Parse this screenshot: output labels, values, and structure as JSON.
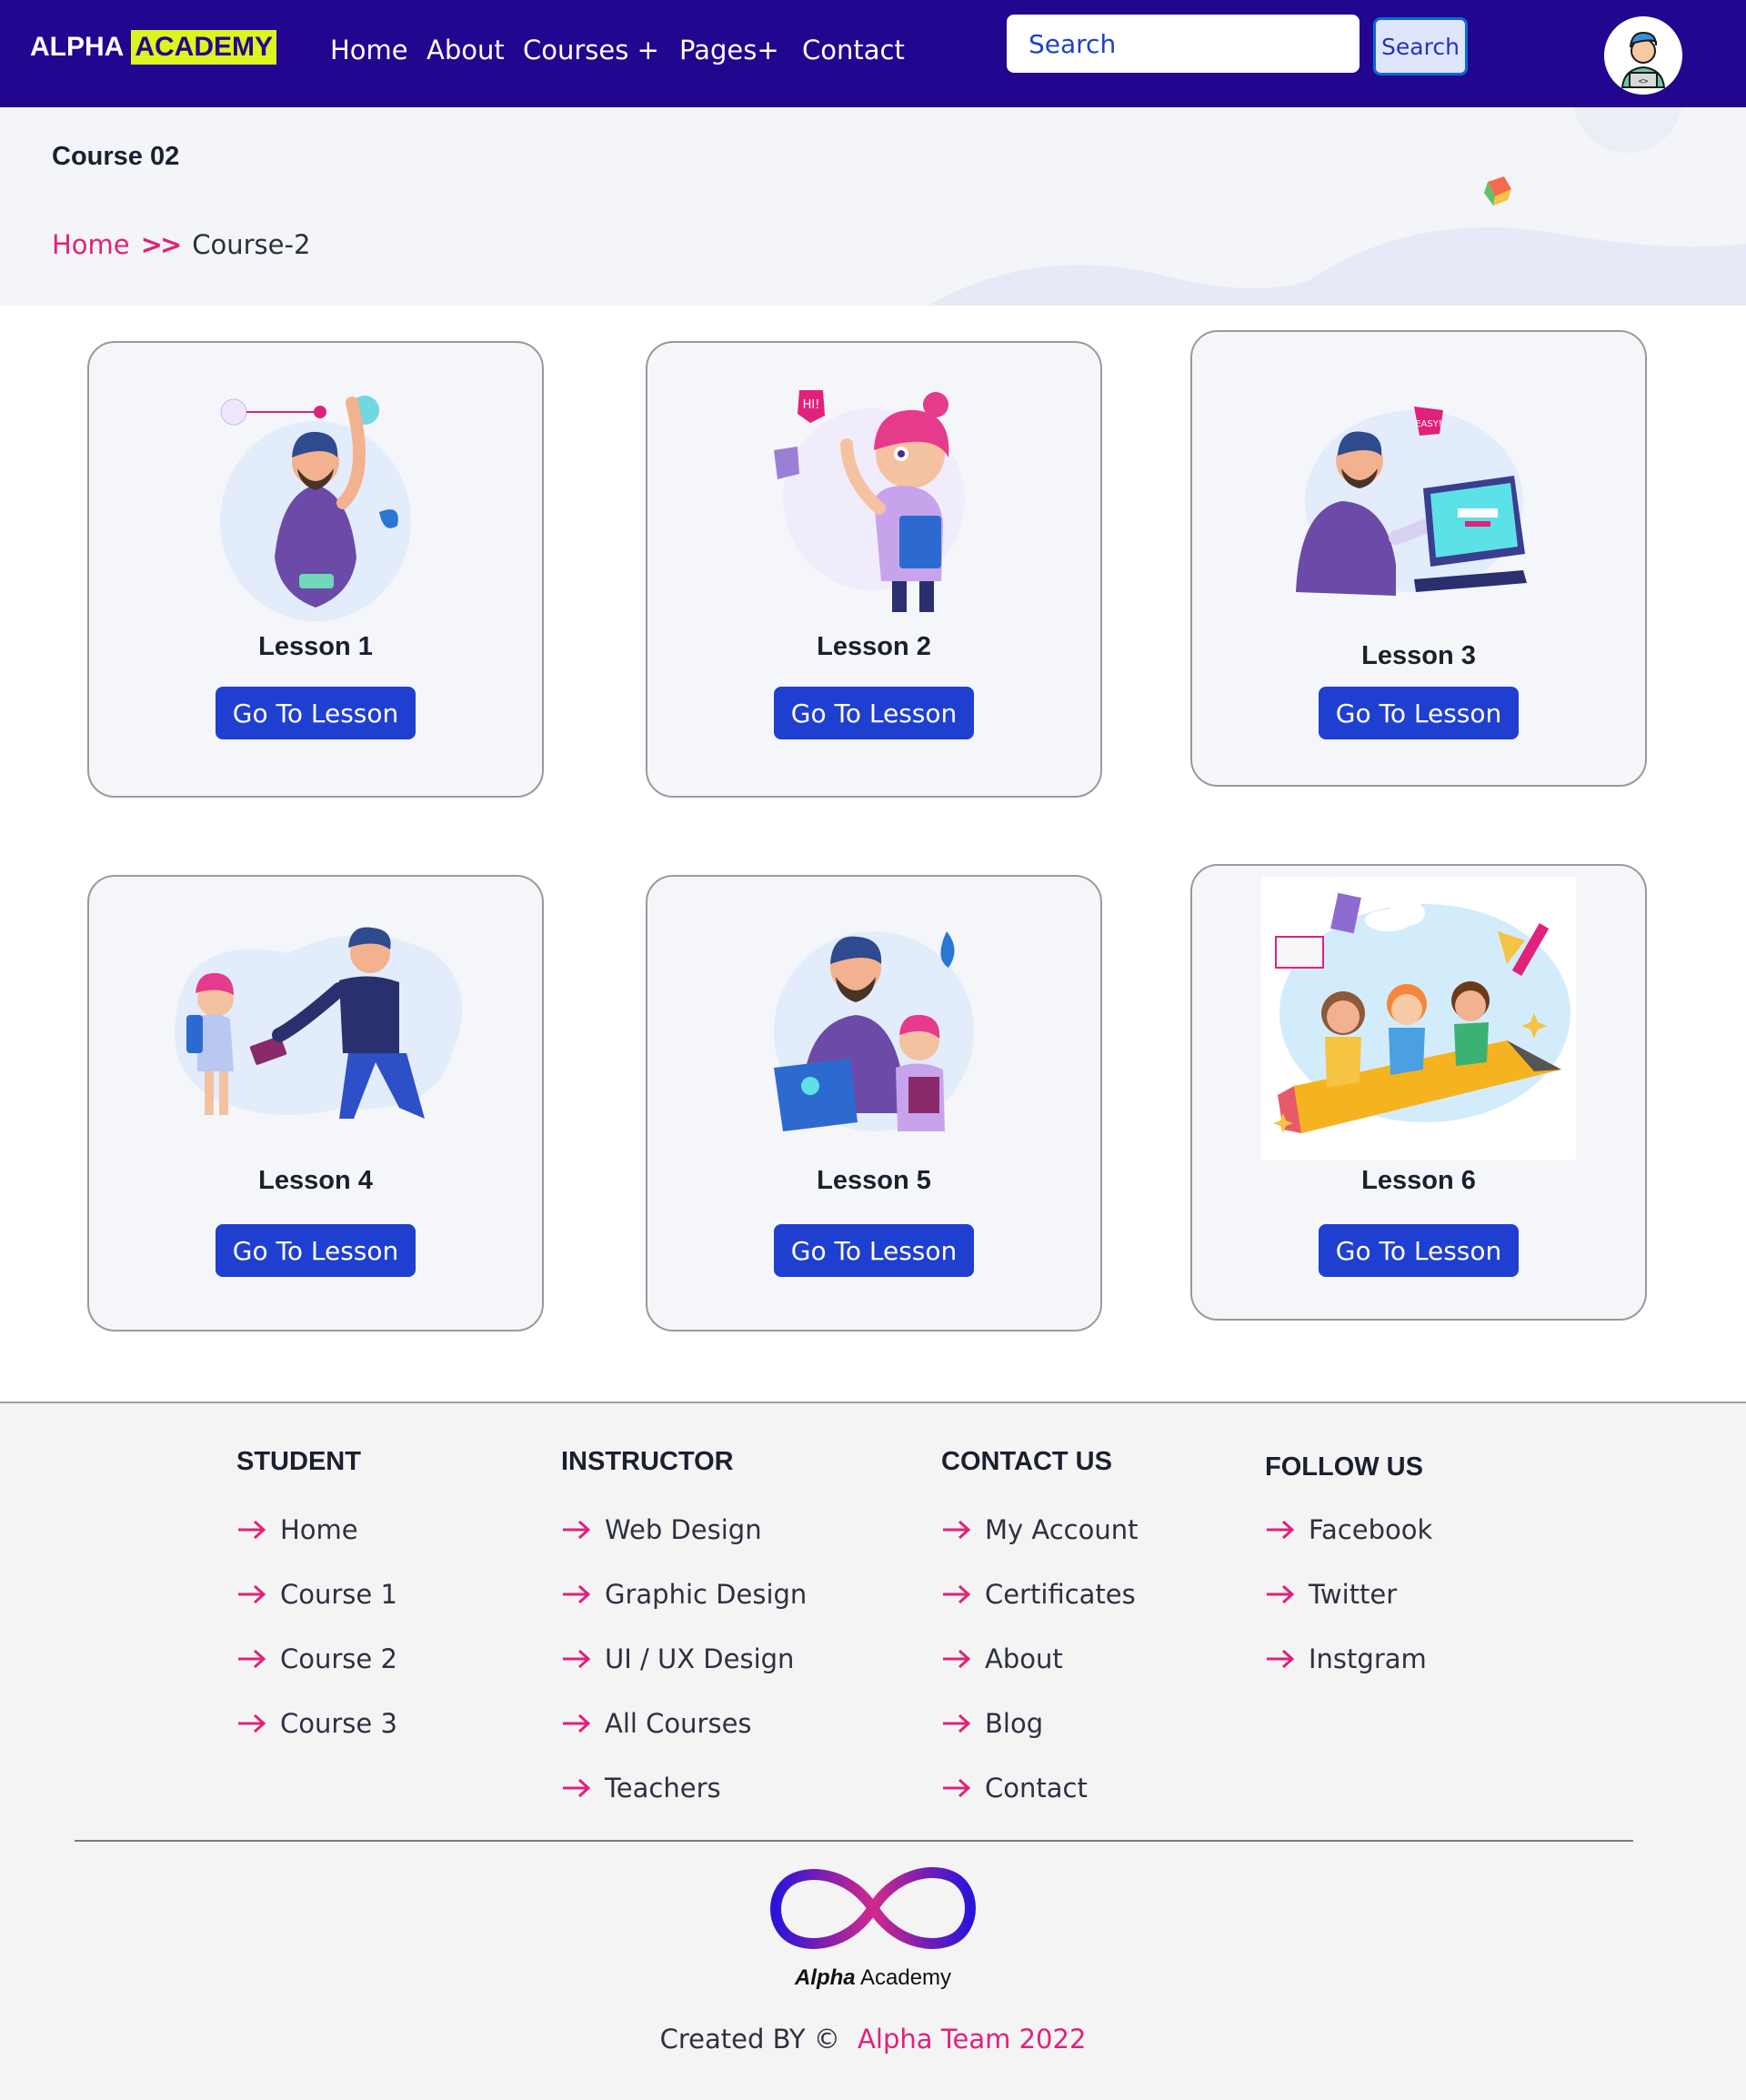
{
  "navbar": {
    "brand_part1": "ALPHA",
    "brand_part2": "ACADEMY",
    "links": [
      "Home",
      "About",
      "Courses +",
      "Pages+",
      "Contact"
    ],
    "search_placeholder": "Search",
    "search_button": "Search"
  },
  "hero": {
    "title": "Course 02",
    "breadcrumb_home": "Home",
    "breadcrumb_separator": ">>",
    "breadcrumb_current": "Course-2"
  },
  "lessons": [
    {
      "title": "Lesson 1",
      "button": "Go To Lesson"
    },
    {
      "title": "Lesson 2",
      "button": "Go To Lesson"
    },
    {
      "title": "Lesson 3",
      "button": "Go To Lesson"
    },
    {
      "title": "Lesson 4",
      "button": "Go To Lesson"
    },
    {
      "title": "Lesson 5",
      "button": "Go To Lesson"
    },
    {
      "title": "Lesson 6",
      "button": "Go To Lesson"
    }
  ],
  "footer": {
    "columns": [
      {
        "heading": "STUDENT",
        "items": [
          "Home",
          "Course 1",
          "Course 2",
          "Course 3"
        ]
      },
      {
        "heading": "INSTRUCTOR",
        "items": [
          "Web Design",
          "Graphic Design",
          "UI / UX Design",
          "All Courses",
          "Teachers"
        ]
      },
      {
        "heading": "CONTACT US",
        "items": [
          "My Account",
          "Certificates",
          "About",
          "Blog",
          "Contact"
        ]
      },
      {
        "heading": "FOLLOW US",
        "items": [
          "Facebook",
          "Twitter",
          "Instgram"
        ]
      }
    ],
    "logo_word1": "Alpha",
    "logo_word2": "Academy",
    "credit_prefix": "Created BY ©",
    "credit_team": "Alpha Team 2022"
  },
  "colors": {
    "navbar_bg": "#22068f",
    "brand_highlight": "#dcf51e",
    "accent_pink": "#e0227a",
    "button_blue": "#1f3fd0"
  }
}
